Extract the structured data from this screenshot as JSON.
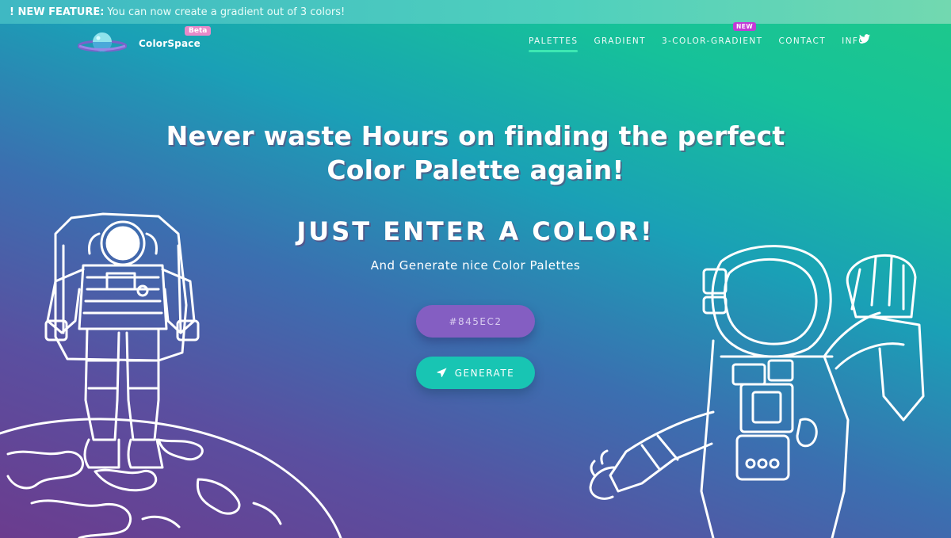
{
  "banner": {
    "label": "! NEW FEATURE:",
    "text": "You can now create a gradient out of 3 colors!"
  },
  "logo": {
    "brand": "ColorSpace",
    "badge": "Beta"
  },
  "nav": {
    "items": [
      {
        "label": "PALETTES",
        "active": true
      },
      {
        "label": "GRADIENT",
        "active": false
      },
      {
        "label": "3-COLOR-GRADIENT",
        "active": false,
        "badge": "NEW"
      },
      {
        "label": "CONTACT",
        "active": false
      },
      {
        "label": "INFO",
        "active": false
      }
    ],
    "social_icon": "twitter-icon"
  },
  "hero": {
    "headline_line1": "Never waste Hours on finding the perfect",
    "headline_line2": "Color Palette again!",
    "subheadline": "JUST ENTER A COLOR!",
    "tagline": "And Generate nice Color Palettes"
  },
  "form": {
    "color_value": "#845EC2",
    "input_color": "#845ec2",
    "button_label": "GENERATE",
    "button_icon": "rocket-icon",
    "button_color": "#18c5b3"
  },
  "illustrations": {
    "left": "astronaut-on-planet-illustration",
    "right": "waving-astronaut-illustration"
  }
}
